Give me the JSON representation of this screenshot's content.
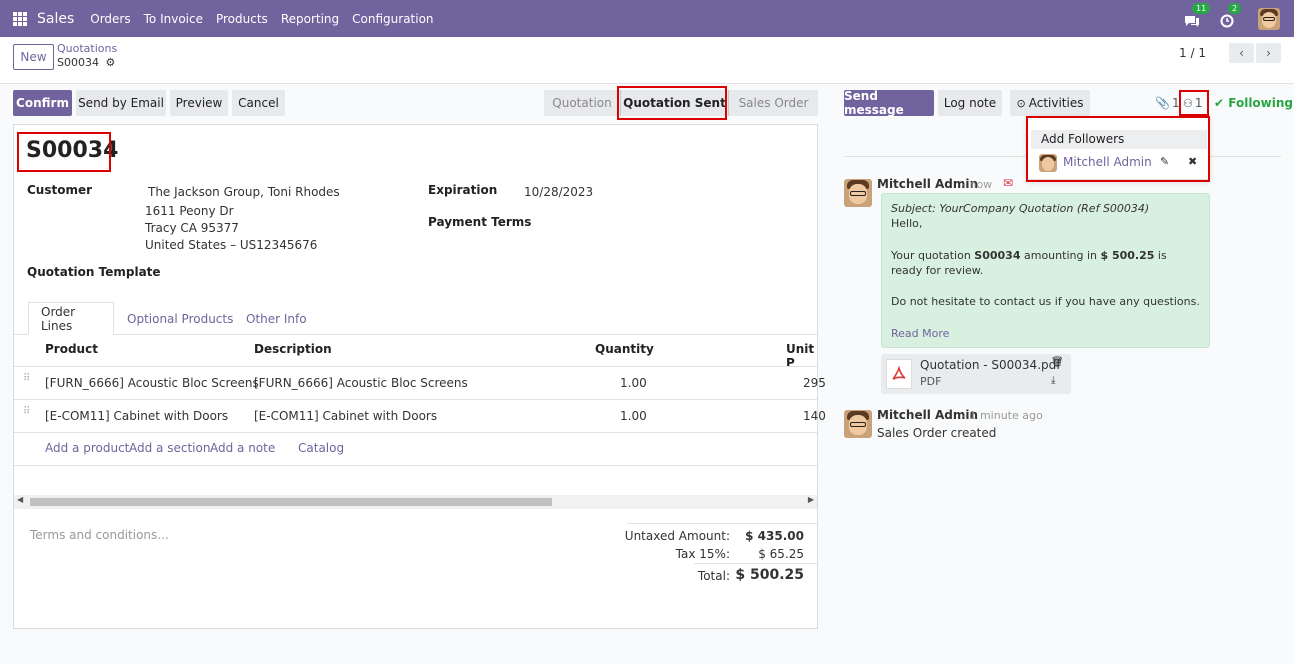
{
  "navbar": {
    "brand": "Sales",
    "menus": [
      "Orders",
      "To Invoice",
      "Products",
      "Reporting",
      "Configuration"
    ],
    "messages_count": "11",
    "activities_count": "2"
  },
  "control_panel": {
    "new_label": "New",
    "breadcrumb_parent": "Quotations",
    "breadcrumb_current": "S00034",
    "pager": "1 / 1"
  },
  "actions": {
    "confirm": "Confirm",
    "send_email": "Send by Email",
    "preview": "Preview",
    "cancel": "Cancel"
  },
  "statusbar": [
    "Quotation",
    "Quotation Sent",
    "Sales Order"
  ],
  "form": {
    "title": "S00034",
    "customer_label": "Customer",
    "customer_name": "The Jackson Group, Toni Rhodes",
    "address_line1": "1611 Peony Dr",
    "address_line2": "Tracy CA 95377",
    "address_line3": "United States – US12345676",
    "expiration_label": "Expiration",
    "expiration_value": "10/28/2023",
    "payment_terms_label": "Payment Terms",
    "quotation_template_label": "Quotation Template"
  },
  "tabs": [
    "Order Lines",
    "Optional Products",
    "Other Info"
  ],
  "table": {
    "headers": [
      "Product",
      "Description",
      "Quantity",
      "Unit P"
    ],
    "rows": [
      {
        "product": "[FURN_6666] Acoustic Bloc Screens",
        "description": "[FURN_6666] Acoustic Bloc Screens",
        "quantity": "1.00",
        "unit_price": "295"
      },
      {
        "product": "[E-COM11] Cabinet with Doors",
        "description": "[E-COM11] Cabinet with Doors",
        "quantity": "1.00",
        "unit_price": "140"
      }
    ],
    "add_product": "Add a product",
    "add_section": "Add a section",
    "add_note": "Add a note",
    "catalog": "Catalog"
  },
  "footer": {
    "terms_placeholder": "Terms and conditions...",
    "untaxed_label": "Untaxed Amount:",
    "untaxed_value": "$ 435.00",
    "tax_label": "Tax 15%:",
    "tax_value": "$ 65.25",
    "total_label": "Total:",
    "total_value": "$ 500.25"
  },
  "chatter": {
    "send_message": "Send message",
    "log_note": "Log note",
    "activities": "Activities",
    "attachments_count": "1",
    "followers_count": "1",
    "following": "Following",
    "popup_add_followers": "Add Followers",
    "popup_follower_name": "Mitchell Admin",
    "msg1_author": "Mitchell Admin",
    "msg1_time": "- now",
    "msg1_subject": "Subject: YourCompany Quotation (Ref S00034)",
    "msg1_hello": "Hello,",
    "msg1_body_a": "Your quotation ",
    "msg1_body_ref": "S00034",
    "msg1_body_b": " amounting in ",
    "msg1_body_amount": "$ 500.25",
    "msg1_body_c": " is ready for review.",
    "msg1_body2": "Do not hesitate to contact us if you have any questions.",
    "read_more": "Read More",
    "attachment_name": "Quotation - S00034.pdf",
    "attachment_type": "PDF",
    "msg2_author": "Mitchell Admin",
    "msg2_time": "- 1 minute ago",
    "msg2_body": "Sales Order created"
  }
}
